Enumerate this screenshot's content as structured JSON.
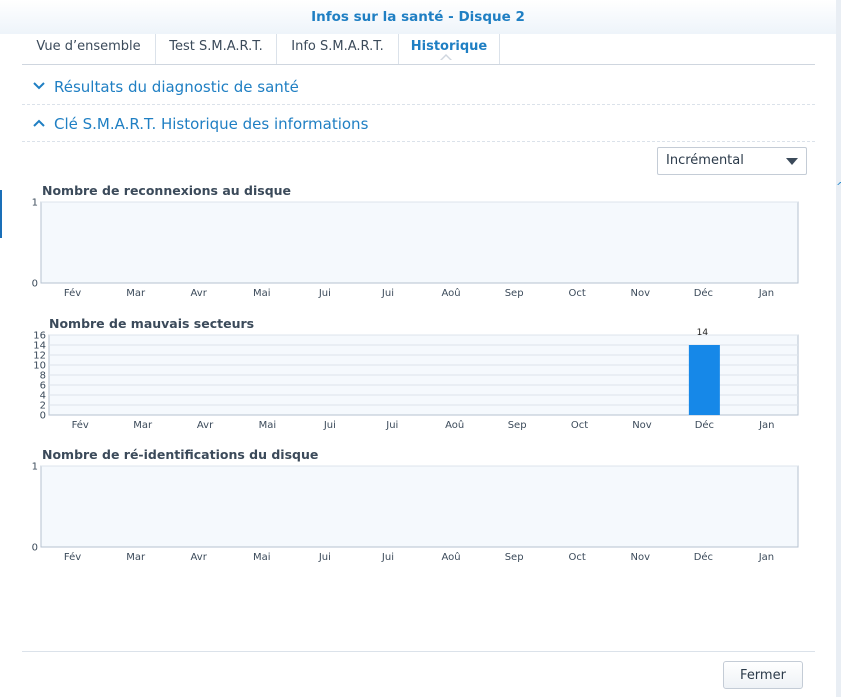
{
  "window": {
    "title": "Infos sur la santé - Disque 2"
  },
  "tabs": [
    {
      "label": "Vue d’ensemble",
      "active": false
    },
    {
      "label": "Test S.M.A.R.T.",
      "active": false
    },
    {
      "label": "Info S.M.A.R.T.",
      "active": false
    },
    {
      "label": "Historique",
      "active": true
    }
  ],
  "sections": {
    "diagnostic": {
      "label": "Résultats du diagnostic de santé",
      "expanded": false
    },
    "history": {
      "label": "Clé S.M.A.R.T. Historique des informations",
      "expanded": true
    }
  },
  "mode_select": {
    "value": "Incrémental"
  },
  "footer": {
    "close_label": "Fermer"
  },
  "colors": {
    "accent": "#1f7fc3",
    "bar": "#1688e8",
    "plot_bg": "#f5f9fd"
  },
  "chart_data": [
    {
      "type": "bar",
      "title": "Nombre de reconnexions au disque",
      "categories": [
        "Fév",
        "Mar",
        "Avr",
        "Mai",
        "Jui",
        "Jui",
        "Aoû",
        "Sep",
        "Oct",
        "Nov",
        "Déc",
        "Jan"
      ],
      "values": [
        0,
        0,
        0,
        0,
        0,
        0,
        0,
        0,
        0,
        0,
        0,
        0
      ],
      "ylim": [
        0,
        1
      ],
      "yticks": [
        0,
        1
      ],
      "grid": true
    },
    {
      "type": "bar",
      "title": "Nombre de mauvais secteurs",
      "categories": [
        "Fév",
        "Mar",
        "Avr",
        "Mai",
        "Jui",
        "Jui",
        "Aoû",
        "Sep",
        "Oct",
        "Nov",
        "Déc",
        "Jan"
      ],
      "values": [
        0,
        0,
        0,
        0,
        0,
        0,
        0,
        0,
        0,
        0,
        14,
        0
      ],
      "data_labels": [
        "",
        "",
        "",
        "",
        "",
        "",
        "",
        "",
        "",
        "",
        "14",
        ""
      ],
      "ylim": [
        0,
        16
      ],
      "yticks": [
        0,
        2,
        4,
        6,
        8,
        10,
        12,
        14,
        16
      ],
      "grid": true
    },
    {
      "type": "bar",
      "title": "Nombre de ré-identifications du disque",
      "categories": [
        "Fév",
        "Mar",
        "Avr",
        "Mai",
        "Jui",
        "Jui",
        "Aoû",
        "Sep",
        "Oct",
        "Nov",
        "Déc",
        "Jan"
      ],
      "values": [
        0,
        0,
        0,
        0,
        0,
        0,
        0,
        0,
        0,
        0,
        0,
        0
      ],
      "ylim": [
        0,
        1
      ],
      "yticks": [
        0,
        1
      ],
      "grid": true
    }
  ]
}
